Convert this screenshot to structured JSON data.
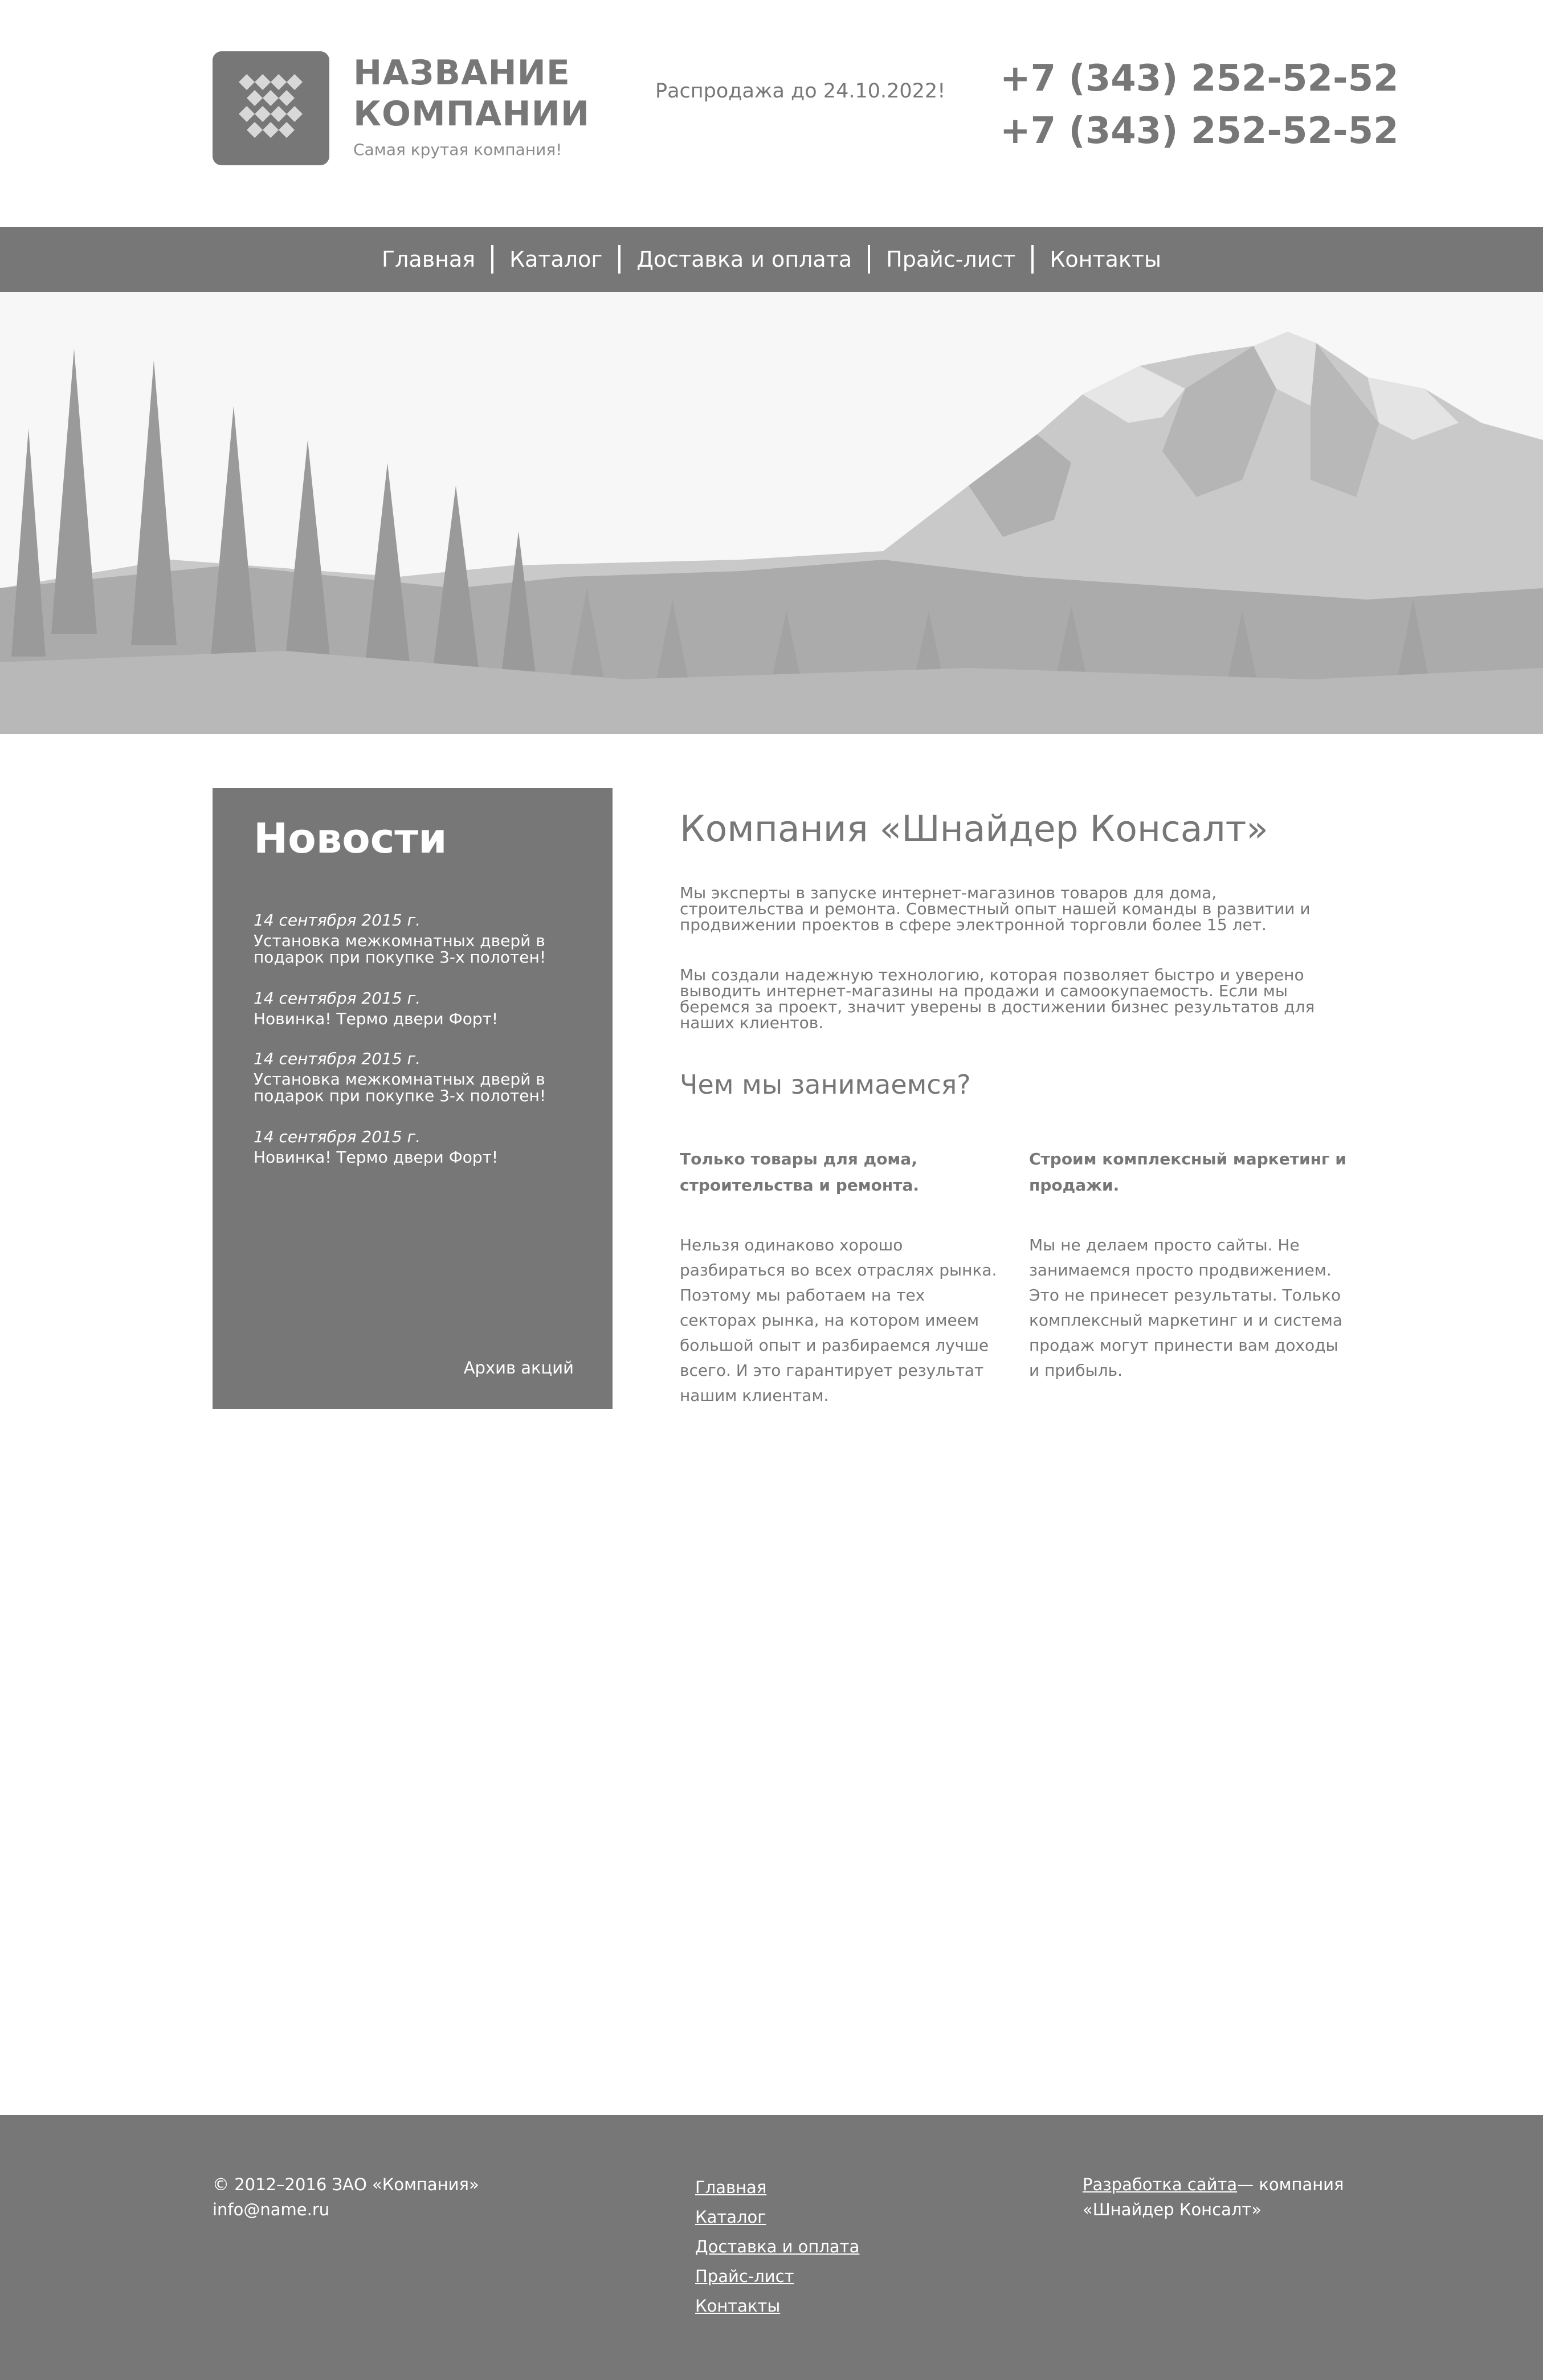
{
  "header": {
    "company_name_line1": "НАЗВАНИЕ",
    "company_name_line2": "КОМПАНИИ",
    "tagline": "Самая крутая компания!",
    "sale_text": "Распродажа до 24.10.2022!",
    "phones": [
      "+7 (343) 252-52-52",
      "+7 (343) 252-52-52"
    ]
  },
  "nav": {
    "items": [
      {
        "label": "Главная"
      },
      {
        "label": "Каталог"
      },
      {
        "label": "Доставка и оплата"
      },
      {
        "label": "Прайс-лист"
      },
      {
        "label": "Контакты"
      }
    ]
  },
  "news": {
    "title": "Новости",
    "items": [
      {
        "date": "14 сентября 2015 г.",
        "text": "Установка межкомнатных дверй в подарок при покупке 3-х полотен!"
      },
      {
        "date": "14 сентября 2015 г.",
        "text": "Новинка! Термо двери Форт!"
      },
      {
        "date": "14 сентября 2015 г.",
        "text": "Установка межкомнатных дверй в подарок при покупке 3-х полотен!"
      },
      {
        "date": "14 сентября 2015 г.",
        "text": "Новинка! Термо двери Форт!"
      }
    ],
    "archive_label": "Архив акций"
  },
  "main": {
    "title": "Компания «Шнайдер Консалт»",
    "paragraphs": [
      "Мы эксперты в запуске интернет-магазинов товаров для дома, строительства и ремонта. Совместный опыт нашей команды в развитии и продвижении проектов в сфере электронной торговли более 15 лет.",
      "Мы создали надежную технологию, которая позволяет быстро и уверено выводить интернет-магазины на продажи и самоокупаемость. Если мы беремся за проект, значит уверены в достижении бизнес результатов для наших клиентов."
    ],
    "what_title": "Чем мы занимаемся?",
    "columns": [
      {
        "heading": "Только товары для дома, строительства и ремонта.",
        "text": "Нельзя одинаково хорошо разбираться во всех отраслях рынка. Поэтому мы работаем на тех секторах рынка, на котором имеем большой опыт и разбираемся лучше всего. И это гарантирует результат нашим клиентам."
      },
      {
        "heading": "Строим комплексный маркетинг и продажи.",
        "text": "Мы не делаем просто сайты. Не занимаемся просто продвижением. Это не принесет результаты. Только комплексный маркетинг и и система продаж могут принести вам доходы и прибыль."
      }
    ]
  },
  "footer": {
    "copyright": "© 2012–2016 ЗАО «Компания»",
    "email": "info@name.ru",
    "links": [
      {
        "label": "Главная"
      },
      {
        "label": "Каталог"
      },
      {
        "label": "Доставка и оплата"
      },
      {
        "label": "Прайс-лист"
      },
      {
        "label": "Контакты"
      }
    ],
    "dev_link": "Разработка сайта",
    "dev_text": "— компания «Шнайдер Консалт»"
  },
  "colors": {
    "primary_gray": "#777777",
    "background": "#ffffff",
    "hero_sky": "#f7f7f7"
  },
  "icons": {
    "logo": "diamond-grid-logo-icon"
  }
}
